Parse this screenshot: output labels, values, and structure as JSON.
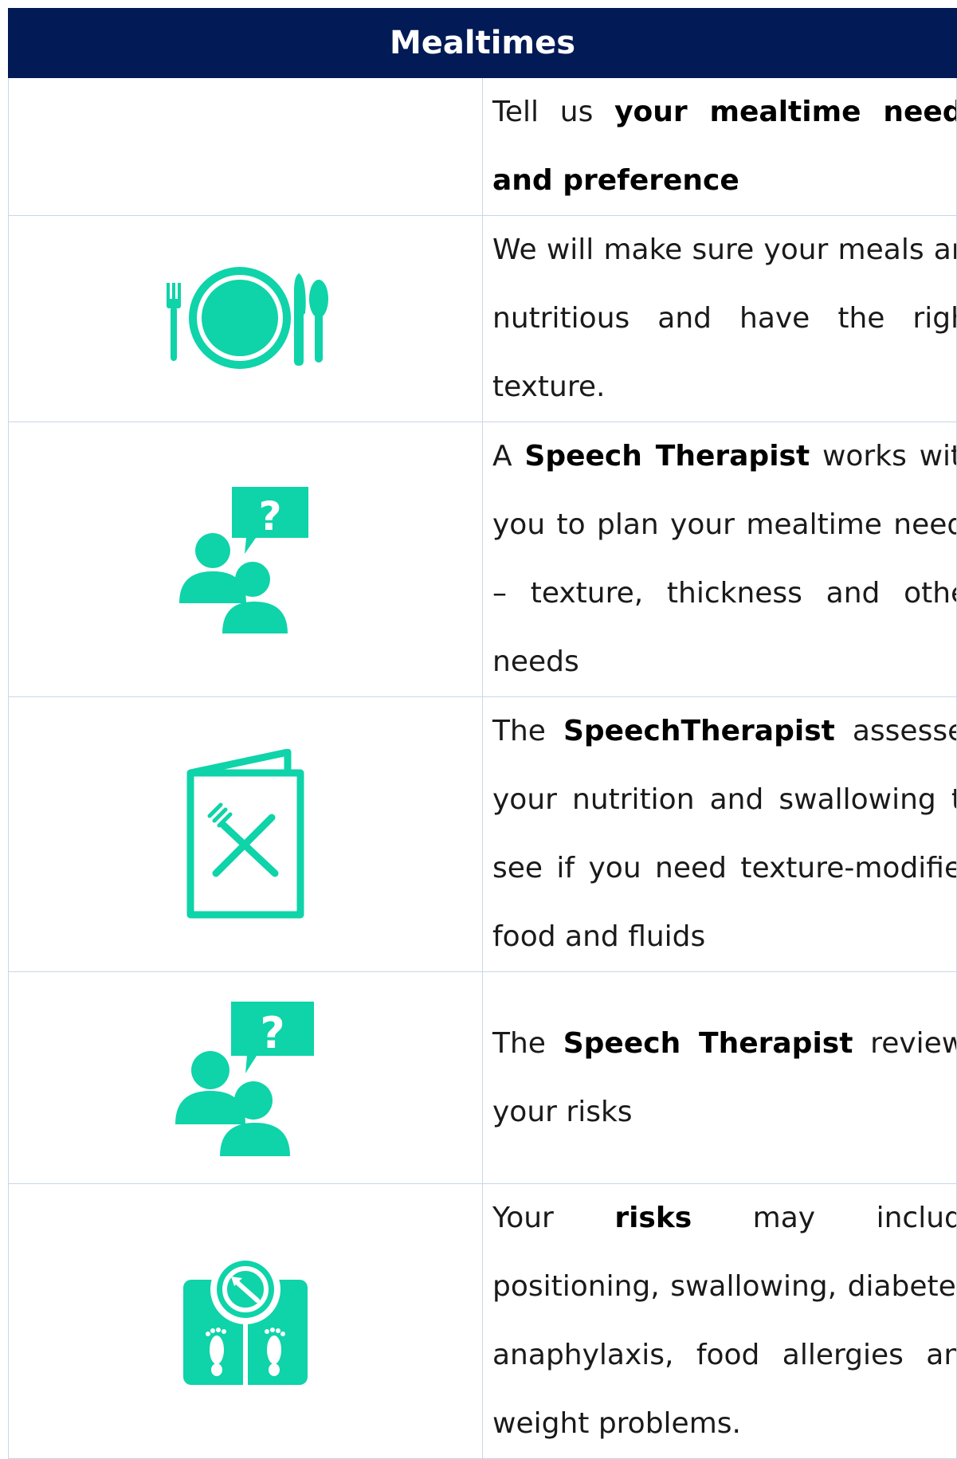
{
  "header": {
    "title": "Mealtimes"
  },
  "colors": {
    "header_bg": "#021a55",
    "icon": "#0fd3a9",
    "border": "#c9d6e8"
  },
  "rows": [
    {
      "icon": "none",
      "parts": [
        {
          "text": "Tell us ",
          "bold": false
        },
        {
          "text": "your mealtime needs and preference",
          "bold": true
        }
      ]
    },
    {
      "icon": "plate-cutlery-icon",
      "parts": [
        {
          "text": "We will make sure your meals are nutritious and have the right texture.",
          "bold": false
        }
      ]
    },
    {
      "icon": "people-question-icon",
      "parts": [
        {
          "text": "A ",
          "bold": false
        },
        {
          "text": "Speech Therapist",
          "bold": true
        },
        {
          "text": " works with you to plan your mealtime needs – texture, thickness and other needs",
          "bold": false
        }
      ]
    },
    {
      "icon": "menu-card-icon",
      "parts": [
        {
          "text": "The ",
          "bold": false
        },
        {
          "text": "SpeechTherapist",
          "bold": true
        },
        {
          "text": " assesses your nutrition and swallowing to see if you need texture-modified food and fluids",
          "bold": false
        }
      ]
    },
    {
      "icon": "people-question-icon",
      "parts": [
        {
          "text": "The ",
          "bold": false
        },
        {
          "text": "Speech Therapist",
          "bold": true
        },
        {
          "text": " reviews your risks",
          "bold": false
        }
      ]
    },
    {
      "icon": "weight-scale-icon",
      "parts": [
        {
          "text": "Your ",
          "bold": false
        },
        {
          "text": "risks",
          "bold": true
        },
        {
          "text": " may include positioning, swallowing, diabetes, anaphylaxis, food allergies and weight problems.",
          "bold": false
        }
      ]
    }
  ]
}
